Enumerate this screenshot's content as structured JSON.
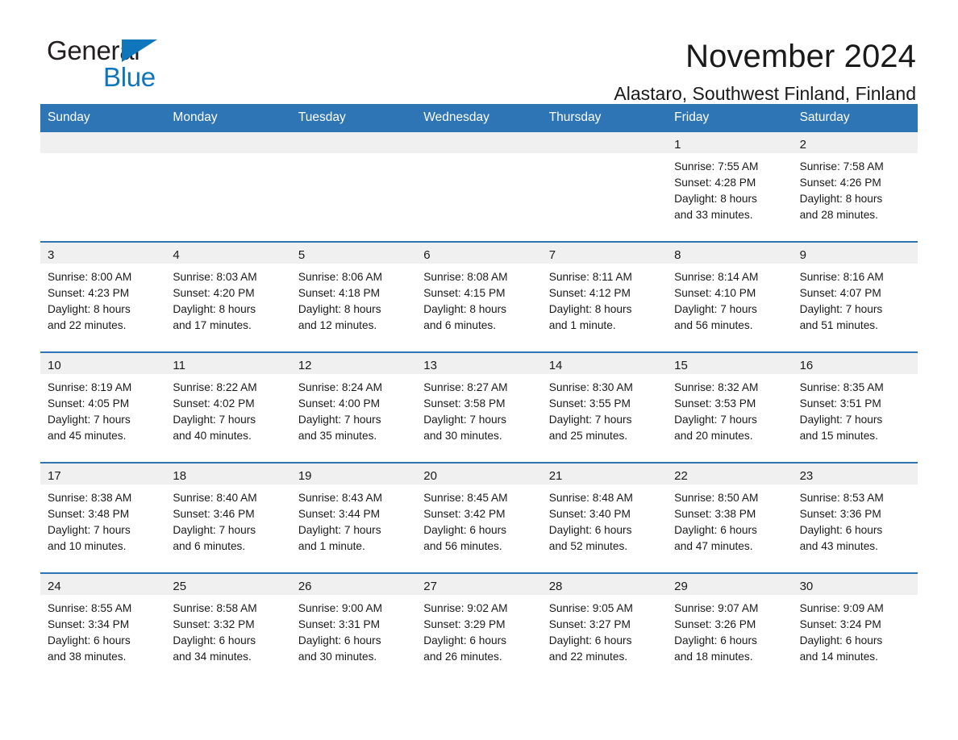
{
  "brand": {
    "name_part1": "General",
    "name_part2": "Blue",
    "triangle_icon": "triangle-icon",
    "accent_color": "#1076bc"
  },
  "header": {
    "month_title": "November 2024",
    "location": "Alastaro, Southwest Finland, Finland",
    "header_bg_color": "#2e75b6",
    "day_band_color": "#f0f0f0"
  },
  "weekdays": [
    "Sunday",
    "Monday",
    "Tuesday",
    "Wednesday",
    "Thursday",
    "Friday",
    "Saturday"
  ],
  "weeks": [
    [
      {
        "date": "",
        "empty": true
      },
      {
        "date": "",
        "empty": true
      },
      {
        "date": "",
        "empty": true
      },
      {
        "date": "",
        "empty": true
      },
      {
        "date": "",
        "empty": true
      },
      {
        "date": "1",
        "sunrise": "Sunrise: 7:55 AM",
        "sunset": "Sunset: 4:28 PM",
        "daylight_1": "Daylight: 8 hours",
        "daylight_2": "and 33 minutes."
      },
      {
        "date": "2",
        "sunrise": "Sunrise: 7:58 AM",
        "sunset": "Sunset: 4:26 PM",
        "daylight_1": "Daylight: 8 hours",
        "daylight_2": "and 28 minutes."
      }
    ],
    [
      {
        "date": "3",
        "sunrise": "Sunrise: 8:00 AM",
        "sunset": "Sunset: 4:23 PM",
        "daylight_1": "Daylight: 8 hours",
        "daylight_2": "and 22 minutes."
      },
      {
        "date": "4",
        "sunrise": "Sunrise: 8:03 AM",
        "sunset": "Sunset: 4:20 PM",
        "daylight_1": "Daylight: 8 hours",
        "daylight_2": "and 17 minutes."
      },
      {
        "date": "5",
        "sunrise": "Sunrise: 8:06 AM",
        "sunset": "Sunset: 4:18 PM",
        "daylight_1": "Daylight: 8 hours",
        "daylight_2": "and 12 minutes."
      },
      {
        "date": "6",
        "sunrise": "Sunrise: 8:08 AM",
        "sunset": "Sunset: 4:15 PM",
        "daylight_1": "Daylight: 8 hours",
        "daylight_2": "and 6 minutes."
      },
      {
        "date": "7",
        "sunrise": "Sunrise: 8:11 AM",
        "sunset": "Sunset: 4:12 PM",
        "daylight_1": "Daylight: 8 hours",
        "daylight_2": "and 1 minute."
      },
      {
        "date": "8",
        "sunrise": "Sunrise: 8:14 AM",
        "sunset": "Sunset: 4:10 PM",
        "daylight_1": "Daylight: 7 hours",
        "daylight_2": "and 56 minutes."
      },
      {
        "date": "9",
        "sunrise": "Sunrise: 8:16 AM",
        "sunset": "Sunset: 4:07 PM",
        "daylight_1": "Daylight: 7 hours",
        "daylight_2": "and 51 minutes."
      }
    ],
    [
      {
        "date": "10",
        "sunrise": "Sunrise: 8:19 AM",
        "sunset": "Sunset: 4:05 PM",
        "daylight_1": "Daylight: 7 hours",
        "daylight_2": "and 45 minutes."
      },
      {
        "date": "11",
        "sunrise": "Sunrise: 8:22 AM",
        "sunset": "Sunset: 4:02 PM",
        "daylight_1": "Daylight: 7 hours",
        "daylight_2": "and 40 minutes."
      },
      {
        "date": "12",
        "sunrise": "Sunrise: 8:24 AM",
        "sunset": "Sunset: 4:00 PM",
        "daylight_1": "Daylight: 7 hours",
        "daylight_2": "and 35 minutes."
      },
      {
        "date": "13",
        "sunrise": "Sunrise: 8:27 AM",
        "sunset": "Sunset: 3:58 PM",
        "daylight_1": "Daylight: 7 hours",
        "daylight_2": "and 30 minutes."
      },
      {
        "date": "14",
        "sunrise": "Sunrise: 8:30 AM",
        "sunset": "Sunset: 3:55 PM",
        "daylight_1": "Daylight: 7 hours",
        "daylight_2": "and 25 minutes."
      },
      {
        "date": "15",
        "sunrise": "Sunrise: 8:32 AM",
        "sunset": "Sunset: 3:53 PM",
        "daylight_1": "Daylight: 7 hours",
        "daylight_2": "and 20 minutes."
      },
      {
        "date": "16",
        "sunrise": "Sunrise: 8:35 AM",
        "sunset": "Sunset: 3:51 PM",
        "daylight_1": "Daylight: 7 hours",
        "daylight_2": "and 15 minutes."
      }
    ],
    [
      {
        "date": "17",
        "sunrise": "Sunrise: 8:38 AM",
        "sunset": "Sunset: 3:48 PM",
        "daylight_1": "Daylight: 7 hours",
        "daylight_2": "and 10 minutes."
      },
      {
        "date": "18",
        "sunrise": "Sunrise: 8:40 AM",
        "sunset": "Sunset: 3:46 PM",
        "daylight_1": "Daylight: 7 hours",
        "daylight_2": "and 6 minutes."
      },
      {
        "date": "19",
        "sunrise": "Sunrise: 8:43 AM",
        "sunset": "Sunset: 3:44 PM",
        "daylight_1": "Daylight: 7 hours",
        "daylight_2": "and 1 minute."
      },
      {
        "date": "20",
        "sunrise": "Sunrise: 8:45 AM",
        "sunset": "Sunset: 3:42 PM",
        "daylight_1": "Daylight: 6 hours",
        "daylight_2": "and 56 minutes."
      },
      {
        "date": "21",
        "sunrise": "Sunrise: 8:48 AM",
        "sunset": "Sunset: 3:40 PM",
        "daylight_1": "Daylight: 6 hours",
        "daylight_2": "and 52 minutes."
      },
      {
        "date": "22",
        "sunrise": "Sunrise: 8:50 AM",
        "sunset": "Sunset: 3:38 PM",
        "daylight_1": "Daylight: 6 hours",
        "daylight_2": "and 47 minutes."
      },
      {
        "date": "23",
        "sunrise": "Sunrise: 8:53 AM",
        "sunset": "Sunset: 3:36 PM",
        "daylight_1": "Daylight: 6 hours",
        "daylight_2": "and 43 minutes."
      }
    ],
    [
      {
        "date": "24",
        "sunrise": "Sunrise: 8:55 AM",
        "sunset": "Sunset: 3:34 PM",
        "daylight_1": "Daylight: 6 hours",
        "daylight_2": "and 38 minutes."
      },
      {
        "date": "25",
        "sunrise": "Sunrise: 8:58 AM",
        "sunset": "Sunset: 3:32 PM",
        "daylight_1": "Daylight: 6 hours",
        "daylight_2": "and 34 minutes."
      },
      {
        "date": "26",
        "sunrise": "Sunrise: 9:00 AM",
        "sunset": "Sunset: 3:31 PM",
        "daylight_1": "Daylight: 6 hours",
        "daylight_2": "and 30 minutes."
      },
      {
        "date": "27",
        "sunrise": "Sunrise: 9:02 AM",
        "sunset": "Sunset: 3:29 PM",
        "daylight_1": "Daylight: 6 hours",
        "daylight_2": "and 26 minutes."
      },
      {
        "date": "28",
        "sunrise": "Sunrise: 9:05 AM",
        "sunset": "Sunset: 3:27 PM",
        "daylight_1": "Daylight: 6 hours",
        "daylight_2": "and 22 minutes."
      },
      {
        "date": "29",
        "sunrise": "Sunrise: 9:07 AM",
        "sunset": "Sunset: 3:26 PM",
        "daylight_1": "Daylight: 6 hours",
        "daylight_2": "and 18 minutes."
      },
      {
        "date": "30",
        "sunrise": "Sunrise: 9:09 AM",
        "sunset": "Sunset: 3:24 PM",
        "daylight_1": "Daylight: 6 hours",
        "daylight_2": "and 14 minutes."
      }
    ]
  ]
}
